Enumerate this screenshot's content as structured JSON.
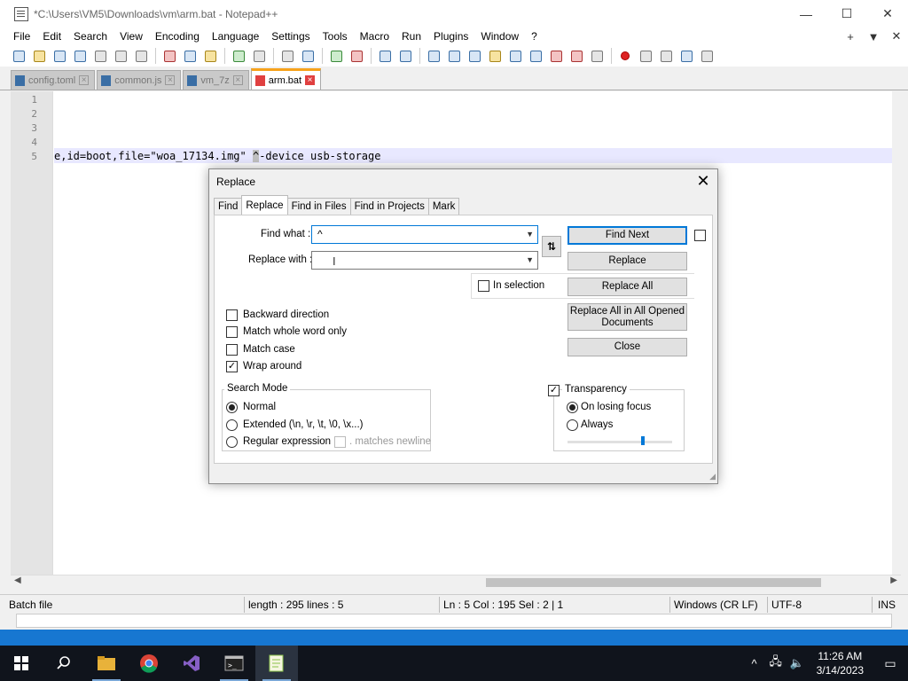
{
  "window": {
    "title": "*C:\\Users\\VM5\\Downloads\\vm\\arm.bat - Notepad++",
    "controls": {
      "minimize": "—",
      "maximize": "☐",
      "close": "✕"
    }
  },
  "menu": {
    "items": [
      "File",
      "Edit",
      "Search",
      "View",
      "Encoding",
      "Language",
      "Settings",
      "Tools",
      "Macro",
      "Run",
      "Plugins",
      "Window",
      "?"
    ],
    "right": {
      "plus": "+",
      "dropdown": "▼",
      "close": "✕"
    }
  },
  "toolbar_icons": [
    "new-file-icon",
    "open-file-icon",
    "save-icon",
    "save-all-icon",
    "close-icon",
    "close-all-icon",
    "print-icon",
    "cut-icon",
    "copy-icon",
    "paste-icon",
    "undo-icon",
    "redo-icon",
    "find-icon",
    "replace-icon",
    "zoom-in-icon",
    "zoom-out-icon",
    "sync-vertical-icon",
    "sync-horizontal-icon",
    "word-wrap-icon",
    "show-all-chars-icon",
    "indent-guide-icon",
    "udl-icon",
    "doc-map-icon",
    "doc-list-icon",
    "function-list-icon",
    "folder-workspace-icon",
    "monitoring-icon",
    "record-macro-icon",
    "stop-macro-icon",
    "play-macro-icon",
    "run-macro-multiple-icon",
    "save-macro-icon"
  ],
  "tabs": [
    {
      "label": "config.toml",
      "active": false
    },
    {
      "label": "common.js",
      "active": false
    },
    {
      "label": "vm_7z",
      "active": false
    },
    {
      "label": "arm.bat",
      "active": true
    }
  ],
  "editor": {
    "line_numbers": [
      "1",
      "2",
      "3",
      "4",
      "5"
    ],
    "line5_pre": "e,id=boot,file=\"woa_17134.img\" ",
    "line5_sel": "^",
    "line5_post": "-device usb-storage"
  },
  "dialog": {
    "title": "Replace",
    "close": "✕",
    "tabs": [
      "Find",
      "Replace",
      "Find in Files",
      "Find in Projects",
      "Mark"
    ],
    "active_tab": "Replace",
    "find_what_label": "Find what :",
    "find_what_value": "^",
    "replace_with_label": "Replace with :",
    "replace_with_value": "",
    "swap_label": "⇅",
    "buttons": {
      "find_next": "Find Next",
      "replace": "Replace",
      "replace_all": "Replace All",
      "replace_all_opened": "Replace All in All Opened Documents",
      "close": "Close"
    },
    "in_selection": "In selection",
    "options": {
      "backward": "Backward direction",
      "whole_word": "Match whole word only",
      "match_case": "Match case",
      "wrap_around": "Wrap around"
    },
    "search_mode": {
      "title": "Search Mode",
      "normal": "Normal",
      "extended": "Extended (\\n, \\r, \\t, \\0, \\x...)",
      "regex": "Regular expression",
      "matches_newline": ". matches newline"
    },
    "transparency": {
      "title": "Transparency",
      "on_losing_focus": "On losing focus",
      "always": "Always",
      "level": 0.72
    }
  },
  "status": {
    "type": "Batch file",
    "length": "length : 295    lines : 5",
    "position": "Ln : 5    Col : 195    Sel : 2 | 1",
    "eol": "Windows (CR LF)",
    "encoding": "UTF-8",
    "mode": "INS"
  },
  "taskbar": {
    "apps": [
      "start-icon",
      "search-icon",
      "file-explorer-icon",
      "chrome-icon",
      "visual-studio-icon",
      "terminal-icon",
      "notepadpp-icon"
    ],
    "time": "11:26 AM",
    "date": "3/14/2023"
  },
  "colors": {
    "accent": "#0078d7",
    "tab_active": "#f7a21b",
    "selection": "#c0c0c0",
    "current_line": "#e8e8ff",
    "taskbar": "#10141c"
  }
}
